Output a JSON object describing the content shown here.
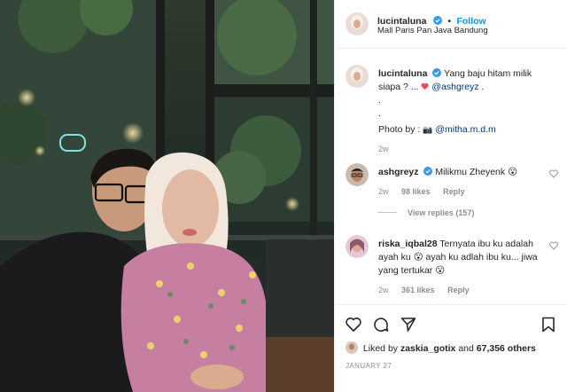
{
  "post": {
    "author": "lucintaluna",
    "follow_separator": "•",
    "follow_label": "Follow",
    "location": "Mall Paris Pan Java Bandung"
  },
  "caption": {
    "username": "lucintaluna",
    "text": "Yang baju hitam milik siapa ? ... ",
    "emoji": "heart",
    "mention": "@ashgreyz",
    "text_end": " .",
    "dot1": ".",
    "dot2": ".",
    "photo_by_label": "Photo by : ",
    "photo_by_glyph": "📷",
    "photo_by_mention": "@mitha.m.d.m",
    "age": "2w"
  },
  "comments": [
    {
      "username": "ashgreyz",
      "verified": true,
      "text": "Milikmu Zheyenk ",
      "emoji": "😮",
      "age": "2w",
      "likes": "98 likes",
      "reply_label": "Reply",
      "view_replies": "View replies (157)"
    },
    {
      "username": "riska_iqbal28",
      "verified": false,
      "text": "Ternyata ibu ku adalah ayah ku 😮 ayah ku adlah ibu ku... jiwa yang tertukar ",
      "emoji": "😮",
      "age": "2w",
      "likes": "361 likes",
      "reply_label": "Reply"
    }
  ],
  "actions": {
    "like_icon": "heart-icon",
    "comment_icon": "comment-icon",
    "share_icon": "share-icon",
    "save_icon": "bookmark-icon"
  },
  "likes": {
    "prefix": "Liked by ",
    "user": "zaskia_gotix",
    "middle": " and ",
    "count": "67,356 others"
  },
  "date": "JANUARY 27",
  "colors": {
    "link": "#0095f6",
    "mention": "#00376b",
    "muted": "#8e8e8e",
    "heart": "#ed4956",
    "verified": "#3897f0"
  }
}
